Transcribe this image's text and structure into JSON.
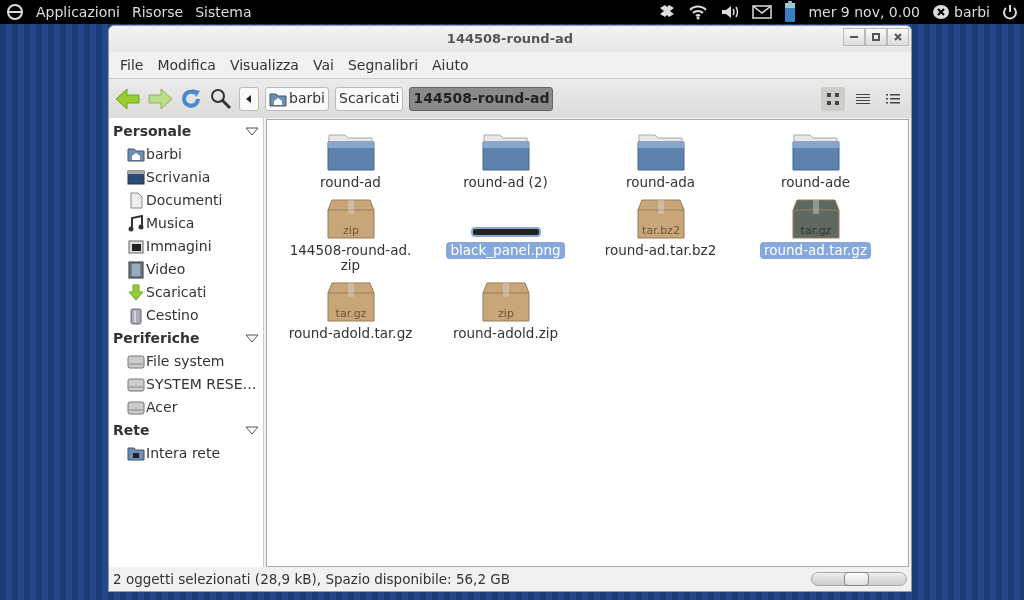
{
  "top_panel": {
    "menus": [
      "Applicazioni",
      "Risorse",
      "Sistema"
    ],
    "clock": "mer  9 nov, 0.00",
    "user": "barbi"
  },
  "window": {
    "title": "144508-round-ad"
  },
  "menubar": [
    "File",
    "Modifica",
    "Visualizza",
    "Vai",
    "Segnalibri",
    "Aiuto"
  ],
  "path": [
    {
      "label": "barbi",
      "kind": "home",
      "selected": false
    },
    {
      "label": "Scaricati",
      "kind": "plain",
      "selected": false
    },
    {
      "label": "144508-round-ad",
      "kind": "plain",
      "selected": true
    }
  ],
  "views": [
    {
      "kind": "icons",
      "selected": true
    },
    {
      "kind": "list",
      "selected": false
    },
    {
      "kind": "compact",
      "selected": false
    }
  ],
  "sidebar": [
    {
      "heading": "Personale",
      "items": [
        {
          "label": "barbi",
          "kind": "home"
        },
        {
          "label": "Scrivania",
          "kind": "desktop"
        },
        {
          "label": "Documenti",
          "kind": "doc"
        },
        {
          "label": "Musica",
          "kind": "music"
        },
        {
          "label": "Immagini",
          "kind": "pictures"
        },
        {
          "label": "Video",
          "kind": "video"
        },
        {
          "label": "Scaricati",
          "kind": "download"
        },
        {
          "label": "Cestino",
          "kind": "trash"
        }
      ]
    },
    {
      "heading": "Periferiche",
      "items": [
        {
          "label": "File system",
          "kind": "drive"
        },
        {
          "label": "SYSTEM RESE…",
          "kind": "drive"
        },
        {
          "label": "Acer",
          "kind": "drive"
        }
      ]
    },
    {
      "heading": "Rete",
      "items": [
        {
          "label": "Intera rete",
          "kind": "network"
        }
      ]
    }
  ],
  "files": [
    {
      "name": "round-ad",
      "kind": "folder",
      "selected": false
    },
    {
      "name": "round-ad (2)",
      "kind": "folder",
      "selected": false
    },
    {
      "name": "round-ada",
      "kind": "folder",
      "selected": false
    },
    {
      "name": "round-ade",
      "kind": "folder",
      "selected": false
    },
    {
      "name": "144508-round-ad.\nzip",
      "kind": "archive",
      "type_label": "zip",
      "selected": false
    },
    {
      "name": "black_panel.png",
      "kind": "image",
      "selected": true
    },
    {
      "name": "round-ad.tar.bz2",
      "kind": "archive",
      "type_label": "tar.bz2",
      "selected": false
    },
    {
      "name": "round-ad.tar.gz",
      "kind": "archive",
      "type_label": "tar.gz",
      "selected": true
    },
    {
      "name": "round-adold.tar.gz",
      "kind": "archive",
      "type_label": "tar.gz",
      "selected": false
    },
    {
      "name": "round-adold.zip",
      "kind": "archive",
      "type_label": "zip",
      "selected": false
    }
  ],
  "status_bar": {
    "text": "2 oggetti selezionati (28,9 kB), Spazio disponibile: 56,2 GB",
    "zoom": {
      "level": 0.45
    }
  }
}
